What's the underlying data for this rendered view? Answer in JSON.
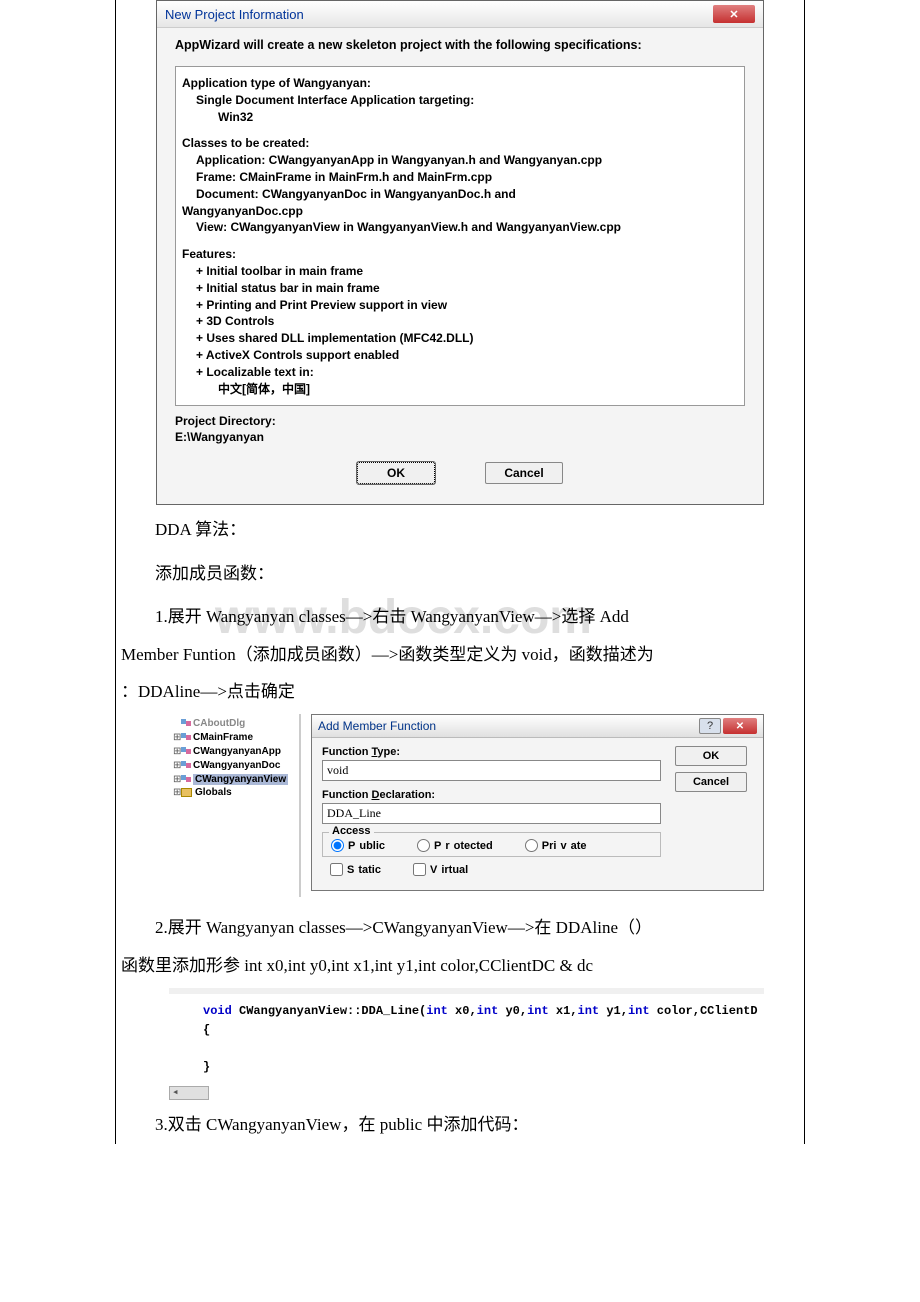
{
  "dialog1": {
    "title": "New Project Information",
    "heading": "AppWizard will create a new skeleton project with the following specifications:",
    "info": {
      "line1": "Application type of Wangyanyan:",
      "line2": "Single Document Interface Application targeting:",
      "line3": "Win32",
      "line4": "Classes to be created:",
      "line5": "Application: CWangyanyanApp in Wangyanyan.h and Wangyanyan.cpp",
      "line6": "Frame: CMainFrame in MainFrm.h and MainFrm.cpp",
      "line7": "Document: CWangyanyanDoc in WangyanyanDoc.h and",
      "line7b": "WangyanyanDoc.cpp",
      "line8": "View: CWangyanyanView in WangyanyanView.h and WangyanyanView.cpp",
      "line9": "Features:",
      "feat1": "+ Initial toolbar in main frame",
      "feat2": "+ Initial status bar in main frame",
      "feat3": "+ Printing and Print Preview support in view",
      "feat4": "+ 3D Controls",
      "feat5": "+ Uses shared DLL implementation (MFC42.DLL)",
      "feat6": "+ ActiveX Controls support enabled",
      "feat7": "+ Localizable text in:",
      "feat8": "中文[简体，中国]"
    },
    "proj_dir_label": "Project Directory:",
    "proj_dir": "E:\\Wangyanyan",
    "ok": "OK",
    "cancel": "Cancel"
  },
  "text": {
    "p1": "DDA 算法：",
    "p2": "添加成员函数：",
    "p3a": "1.展开 Wangyanyan classes—>右击 WangyanyanView—>选择 Add",
    "p3b": "Member Funtion（添加成员函数）—>函数类型定义为 void，函数描述为",
    "p3c": "：DDAline—>点击确定",
    "p4a": "2.展开 Wangyanyan classes—>CWangyanyanView—>在 DDAline（）",
    "p4b": "函数里添加形参 int x0,int y0,int x1,int y1,int color,CClientDC & dc",
    "p5": "3.双击 CWangyanyanView，在 public 中添加代码："
  },
  "tree": {
    "item0": "CAboutDlg",
    "item1": "CMainFrame",
    "item2": "CWangyanyanApp",
    "item3": "CWangyanyanDoc",
    "item4": "CWangyanyanView",
    "item5": "Globals"
  },
  "dialog2": {
    "title": "Add Member Function",
    "func_type_label": "Function Type:",
    "func_type_value": "void",
    "func_decl_label": "Function Declaration:",
    "func_decl_value": "DDA_Line",
    "access_label": "Access",
    "radio_public": "Public",
    "radio_protected": "Protected",
    "radio_private": "Private",
    "check_static": "Static",
    "check_virtual": "Virtual",
    "ok": "OK",
    "cancel": "Cancel"
  },
  "code": {
    "sig_prefix": "void",
    "sig_class": " CWangyanyanView::DDA_Line(",
    "sig_p1t": "int",
    "sig_p1n": " x0,",
    "sig_p2t": "int",
    "sig_p2n": " y0,",
    "sig_p3t": "int",
    "sig_p3n": " x1,",
    "sig_p4t": "int",
    "sig_p4n": " y1,",
    "sig_p5t": "int",
    "sig_p5n": " color,CClientD",
    "brace_open": "{",
    "brace_close": "}"
  },
  "watermark": "www.bdocx.com"
}
